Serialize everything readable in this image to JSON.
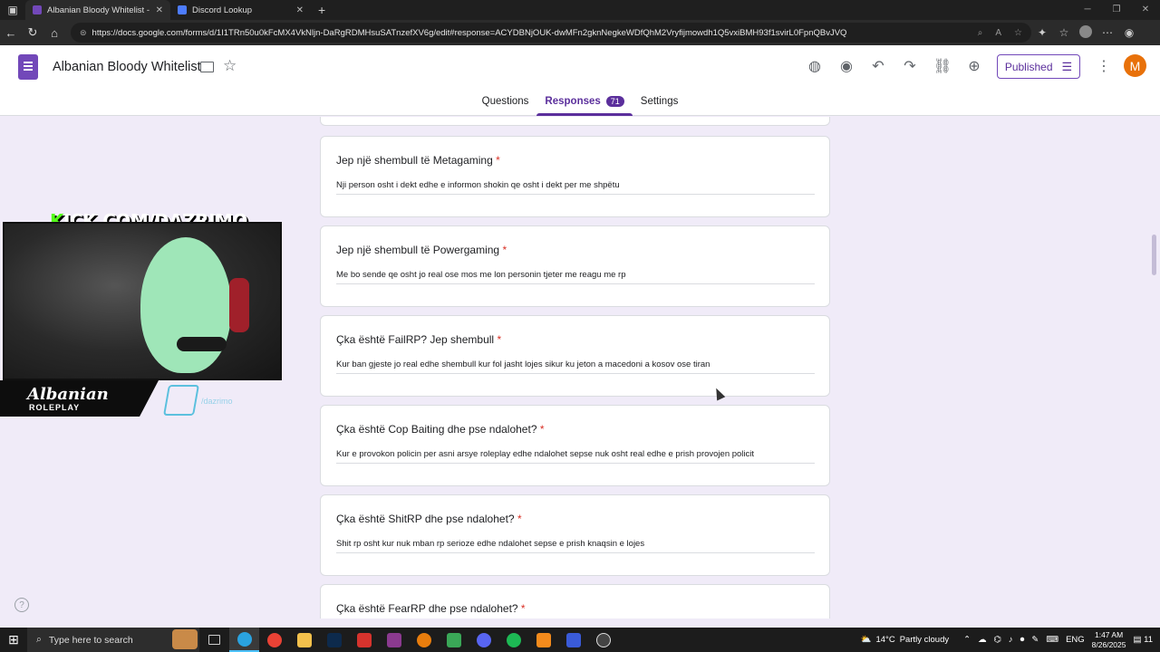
{
  "browser": {
    "tabs": [
      {
        "title": "Albanian Bloody Whitelist - Goog",
        "favicon_color": "#7248b9",
        "active": true
      },
      {
        "title": "Discord Lookup",
        "favicon_color": "#4d7cfe",
        "active": false
      }
    ],
    "new_tab": "+",
    "url": "https://docs.google.com/forms/d/1I1TRn50u0kFcMX4VkNljn-DaRgRDMHsuSATnzefXV6g/edit#response=ACYDBNjOUK-dwMFn2gknNegkeWDfQhM2Vryfijmowdh1Q5vxiBMH93f1svirL0FpnQBvJVQ"
  },
  "forms": {
    "title": "Albanian Bloody Whitelist",
    "published_label": "Published",
    "avatar_letter": "M",
    "accent": "#7248b9",
    "tabs": [
      {
        "label": "Questions",
        "active": false
      },
      {
        "label": "Responses",
        "active": true,
        "count": "71"
      },
      {
        "label": "Settings",
        "active": false
      }
    ]
  },
  "questions": [
    {
      "title": "Jep një shembull të Metagaming",
      "required": "*",
      "answer": "Nji person osht i dekt edhe e informon shokin qe osht i dekt per me shpëtu"
    },
    {
      "title": "Jep një shembull të Powergaming",
      "required": "*",
      "answer": "Me bo sende qe osht jo real ose mos me lon personin tjeter me reagu me rp"
    },
    {
      "title": "Çka është FailRP? Jep shembull",
      "required": "*",
      "answer": "Kur ban gjeste jo real edhe shembull kur fol jasht lojes sikur ku jeton a macedoni a kosov ose tiran"
    },
    {
      "title": "Çka është Cop Baiting dhe pse ndalohet?",
      "required": "*",
      "answer": "Kur e provokon policin per asni arsye roleplay edhe ndalohet sepse nuk osht real edhe e prish provojen policit"
    },
    {
      "title": "Çka është ShitRP dhe pse ndalohet?",
      "required": "*",
      "answer": "Shit rp osht kur nuk mban rp serioze edhe ndalohet sepse e prish knaqsin e lojes"
    },
    {
      "title": "Çka është FearRP dhe pse ndalohet?",
      "required": "*",
      "answer": ""
    }
  ],
  "overlay": {
    "kick_k": "K",
    "kick_rest": "ICK.COM/DAZRIMO",
    "rp_logo": "Albanian",
    "rp_sub": "ROLEPLAY",
    "discord_handle": "/dazrimo"
  },
  "help_symbol": "?",
  "taskbar": {
    "search_placeholder": "Type here to search",
    "temperature": "14°C",
    "weather": "Partly cloudy",
    "language": "ENG",
    "time": "1:47 AM",
    "date": "8/26/2025",
    "notif_count": "11"
  }
}
